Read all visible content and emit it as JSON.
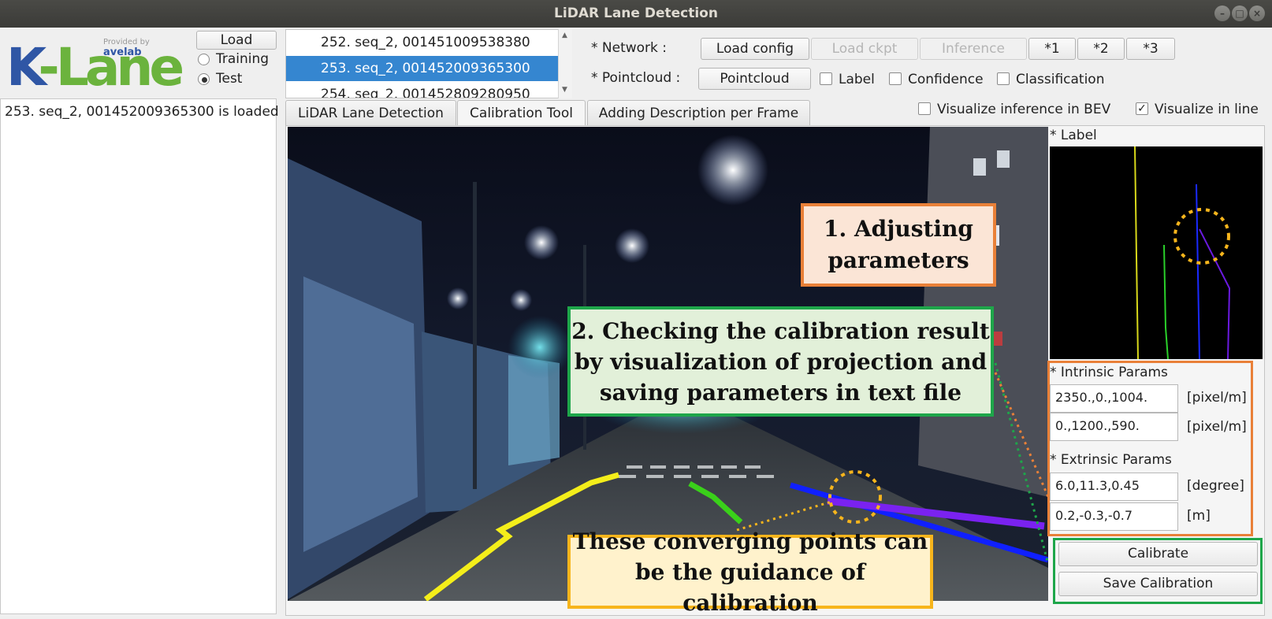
{
  "window": {
    "title": "LiDAR Lane Detection",
    "controls": [
      "minimize",
      "maximize",
      "close"
    ]
  },
  "logo": {
    "text_k": "K",
    "text_rest": "-Lane",
    "provided_by": "Provided by",
    "brand": "avelab"
  },
  "load_panel": {
    "load_label": "Load",
    "mode_training": "Training",
    "mode_test": "Test",
    "selected_mode": "Test",
    "status": "253. seq_2, 001452009365300 is loaded"
  },
  "file_list": {
    "items": [
      {
        "label": "252. seq_2, 001451009538380"
      },
      {
        "label": "253. seq_2, 001452009365300"
      },
      {
        "label": "254. seq_2, 001452809280950"
      }
    ],
    "selected_index": 1
  },
  "network": {
    "label": "* Network :",
    "load_config": "Load config",
    "load_ckpt": "Load ckpt",
    "inference": "Inference",
    "preset1": "*1",
    "preset2": "*2",
    "preset3": "*3"
  },
  "pointcloud": {
    "label": "* Pointcloud :",
    "button": "Pointcloud",
    "label_check": "Label",
    "confidence_check": "Confidence",
    "classification_check": "Classification"
  },
  "visualize": {
    "bev": "Visualize inference in BEV",
    "bev_checked": false,
    "line": "Visualize in line",
    "line_checked": true,
    "check_mark": "✓"
  },
  "tabs": [
    {
      "label": "LiDAR Lane Detection"
    },
    {
      "label": "Calibration Tool"
    },
    {
      "label": "Adding Description per Frame"
    }
  ],
  "active_tab": 1,
  "label_section": {
    "title": "* Label"
  },
  "intrinsic": {
    "title": "* Intrinsic Params",
    "row1_value": "2350.,0.,1004.",
    "row1_unit": "[pixel/m]",
    "row2_value": "0.,1200.,590.",
    "row2_unit": "[pixel/m]"
  },
  "extrinsic": {
    "title": "* Extrinsic Params",
    "row1_value": "6.0,11.3,0.45",
    "row1_unit": "[degree]",
    "row2_value": "0.2,-0.3,-0.7",
    "row2_unit": "[m]"
  },
  "actions": {
    "calibrate": "Calibrate",
    "save_calibration": "Save Calibration"
  },
  "annotations": {
    "adjust_line1": "1. Adjusting",
    "adjust_line2": "parameters",
    "check_line1": "2. Checking the calibration result",
    "check_line2": "by visualization of projection and",
    "check_line3": "saving parameters in text file",
    "converge_line1": "These converging points can",
    "converge_line2": "be the guidance of calibration"
  },
  "colors": {
    "accent_selection": "#3586d0",
    "adjust_box_border": "#e98038",
    "adjust_box_fill": "#fbe5d6",
    "check_box_border": "#1ea64a",
    "check_box_fill": "#e2f0d9",
    "converge_box_border": "#f7b51c",
    "converge_box_fill": "#fff2cc",
    "lane_yellow": "#f4ee1a",
    "lane_green": "#3ad11a",
    "lane_blue": "#1020ff",
    "lane_purple": "#7a22f0"
  }
}
